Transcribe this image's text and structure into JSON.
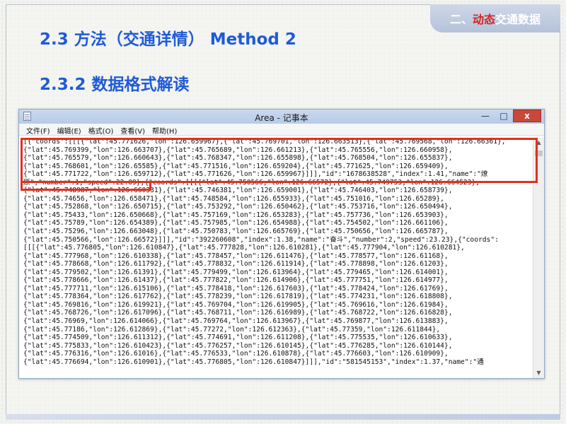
{
  "slide": {
    "badge_prefix": "二、",
    "badge_highlight": "动态",
    "badge_rest": "交通数据",
    "title": "2.3 方法（交通详情） Method 2",
    "subtitle": "2.3.2 数据格式解读"
  },
  "notepad": {
    "title": "Area - 记事本",
    "minimize": "—",
    "maximize": "□",
    "close": "x",
    "menu": [
      {
        "label": "文件(F)"
      },
      {
        "label": "编辑(E)"
      },
      {
        "label": "格式(O)"
      },
      {
        "label": "查看(V)"
      },
      {
        "label": "帮助(H)"
      }
    ],
    "lines": [
      "[{\"coords\":[[[{\"lat\":45.771626,\"lon\":126.659967},{\"lat\":45.769701,\"lon\":126.663513},{\"lat\":45.769568,\"lon\":126.66361},",
      "{\"lat\":45.769399,\"lon\":126.663707},{\"lat\":45.765689,\"lon\":126.661213},{\"lat\":45.765556,\"lon\":126.660958},",
      "{\"lat\":45.765579,\"lon\":126.660643},{\"lat\":45.768347,\"lon\":126.655898},{\"lat\":45.768504,\"lon\":126.655837},",
      "{\"lat\":45.768601,\"lon\":126.65585},{\"lat\":45.771516,\"lon\":126.659204},{\"lat\":45.771625,\"lon\":126.659409},",
      "{\"lat\":45.771722,\"lon\":126.659712},{\"lat\":45.771626,\"lon\":126.659967}]]],\"id\":\"1678638528\",\"index\":1.41,\"name\":\"燎",
      "原\",\"number\":1,\"speed\":22.09},{\"coords\":[[[{\"lat\":45.750566,\"lon\":126.66572},{\"lat\":45.749753,\"lon\":126.664523},",
      "{\"lat\":45.748987,\"lon\":126.660331},{\"lat\":45.746381,\"lon\":126.659001},{\"lat\":45.746403,\"lon\":126.658739},",
      "{\"lat\":45.74656,\"lon\":126.658471},{\"lat\":45.748584,\"lon\":126.655933},{\"lat\":45.751016,\"lon\":126.65289},",
      "{\"lat\":45.752868,\"lon\":126.650715},{\"lat\":45.753292,\"lon\":126.650462},{\"lat\":45.753716,\"lon\":126.650494},",
      "{\"lat\":45.75433,\"lon\":126.650668},{\"lat\":45.757169,\"lon\":126.653283},{\"lat\":45.757736,\"lon\":126.653903},",
      "{\"lat\":45.75789,\"lon\":126.654389},{\"lat\":45.757985,\"lon\":126.654988},{\"lat\":45.754502,\"lon\":126.661106},",
      "{\"lat\":45.75296,\"lon\":126.663048},{\"lat\":45.750783,\"lon\":126.665769},{\"lat\":45.750656,\"lon\":126.665787},",
      "{\"lat\":45.750566,\"lon\":126.66572}]]],\"id\":\"392260608\",\"index\":1.38,\"name\":\"奋斗\",\"number\":2,\"speed\":23.23},{\"coords\":",
      "[[[{\"lat\":45.776805,\"lon\":126.610847},{\"lat\":45.777828,\"lon\":126.610281},{\"lat\":45.777904,\"lon\":126.610281},",
      "{\"lat\":45.777968,\"lon\":126.610338},{\"lat\":45.778457,\"lon\":126.611476},{\"lat\":45.778577,\"lon\":126.61168},",
      "{\"lat\":45.778668,\"lon\":126.611792},{\"lat\":45.778832,\"lon\":126.611914},{\"lat\":45.778898,\"lon\":126.61203},",
      "{\"lat\":45.779502,\"lon\":126.61391},{\"lat\":45.779499,\"lon\":126.613964},{\"lat\":45.779465,\"lon\":126.614001},",
      "{\"lat\":45.778666,\"lon\":126.61437},{\"lat\":45.777822,\"lon\":126.614906},{\"lat\":45.777751,\"lon\":126.614977},",
      "{\"lat\":45.777711,\"lon\":126.615106},{\"lat\":45.778418,\"lon\":126.617603},{\"lat\":45.778424,\"lon\":126.61769},",
      "{\"lat\":45.778364,\"lon\":126.617762},{\"lat\":45.778239,\"lon\":126.617819},{\"lat\":45.774231,\"lon\":126.618808},",
      "{\"lat\":45.769816,\"lon\":126.619921},{\"lat\":45.769704,\"lon\":126.619905},{\"lat\":45.769616,\"lon\":126.61984},",
      "{\"lat\":45.768726,\"lon\":126.617096},{\"lat\":45.768711,\"lon\":126.616989},{\"lat\":45.768722,\"lon\":126.616828},",
      "{\"lat\":45.76969,\"lon\":126.614066},{\"lat\":45.769764,\"lon\":126.613967},{\"lat\":45.769877,\"lon\":126.613883},",
      "{\"lat\":45.77186,\"lon\":126.612869},{\"lat\":45.77272,\"lon\":126.612363},{\"lat\":45.77359,\"lon\":126.611844},",
      "{\"lat\":45.774509,\"lon\":126.611312},{\"lat\":45.774691,\"lon\":126.611208},{\"lat\":45.775535,\"lon\":126.610633},",
      "{\"lat\":45.775833,\"lon\":126.610423},{\"lat\":45.776257,\"lon\":126.610145},{\"lat\":45.776285,\"lon\":126.610144},",
      "{\"lat\":45.776316,\"lon\":126.61016},{\"lat\":45.776533,\"lon\":126.610878},{\"lat\":45.776603,\"lon\":126.610909},",
      "{\"lat\":45.776694,\"lon\":126.610901},{\"lat\":45.776805,\"lon\":126.610847}]]],\"id\":\"581545153\",\"index\":1.37,\"name\":\"通"
    ]
  },
  "colors": {
    "title_blue": "#1f5bd8",
    "highlight_red": "#e2301f",
    "badge_red": "#d5231e"
  }
}
